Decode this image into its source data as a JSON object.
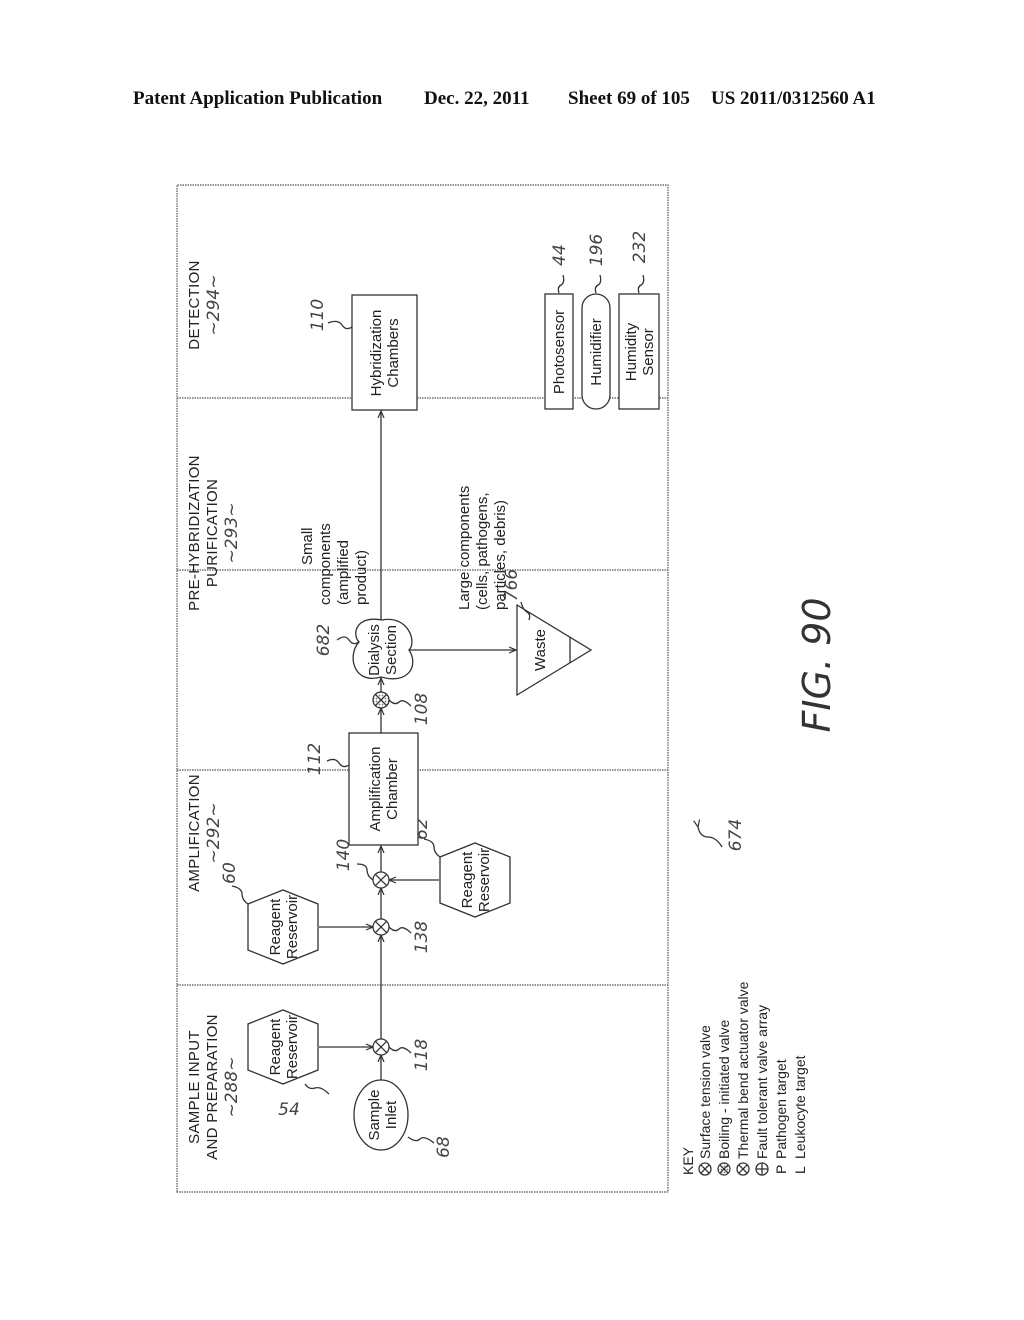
{
  "header": {
    "publication": "Patent Application Publication",
    "date": "Dec. 22, 2011",
    "sheet": "Sheet 69 of 105",
    "number": "US 2011/0312560 A1"
  },
  "figure": {
    "label": "FIG. 90",
    "ref": "674",
    "sections": [
      {
        "line1": "SAMPLE INPUT",
        "line2": "AND PREPARATION",
        "ref": "~288~"
      },
      {
        "line1": "AMPLIFICATION",
        "line2": "",
        "ref": "~292~"
      },
      {
        "line1": "PRE-HYBRIDIZATION",
        "line2": "PURIFICATION",
        "ref": "~293~"
      },
      {
        "line1": "DETECTION",
        "line2": "",
        "ref": "~294~"
      }
    ],
    "nodes": {
      "sample_inlet": {
        "line1": "Sample",
        "line2": "Inlet",
        "ref": "68"
      },
      "reagent_54": {
        "line1": "Reagent",
        "line2": "Reservoir",
        "ref": "54"
      },
      "reagent_60": {
        "line1": "Reagent",
        "line2": "Reservoir",
        "ref": "60"
      },
      "reagent_62": {
        "line1": "Reagent",
        "line2": "Reservoir",
        "ref": "62"
      },
      "amplification": {
        "line1": "Amplification",
        "line2": "Chamber",
        "ref": "112"
      },
      "dialysis": {
        "line1": "Dialysis",
        "line2": "Section",
        "ref": "682"
      },
      "waste": {
        "line1": "Waste",
        "ref": "766"
      },
      "hybridization": {
        "line1": "Hybridization",
        "line2": "Chambers",
        "ref": "110"
      },
      "photosensor": {
        "line1": "Photosensor",
        "ref": "44"
      },
      "humidifier": {
        "line1": "Humidifier",
        "ref": "196"
      },
      "humidity_sensor": {
        "line1": "Humidity",
        "line2": "Sensor",
        "ref": "232"
      }
    },
    "valves": {
      "v118": {
        "ref": "118"
      },
      "v138": {
        "ref": "138"
      },
      "v140": {
        "ref": "140"
      },
      "v108": {
        "ref": "108"
      }
    },
    "annotations": {
      "small": [
        "Small",
        "components",
        "(amplified",
        "product)"
      ],
      "large": [
        "Large components",
        "(cells, pathogens,",
        "particles, debris)"
      ]
    },
    "key": {
      "title": "KEY",
      "items": [
        {
          "symbol": "⊗",
          "label": "Surface tension valve"
        },
        {
          "symbol": "⊗",
          "label": "Boiling - initiated valve"
        },
        {
          "symbol": "⊗",
          "label": "Thermal bend actuator valve"
        },
        {
          "symbol": "⊕",
          "label": "Fault tolerant valve array"
        },
        {
          "symbol": "P",
          "label": "Pathogen target"
        },
        {
          "symbol": "L",
          "label": "Leukocyte target"
        }
      ]
    }
  }
}
